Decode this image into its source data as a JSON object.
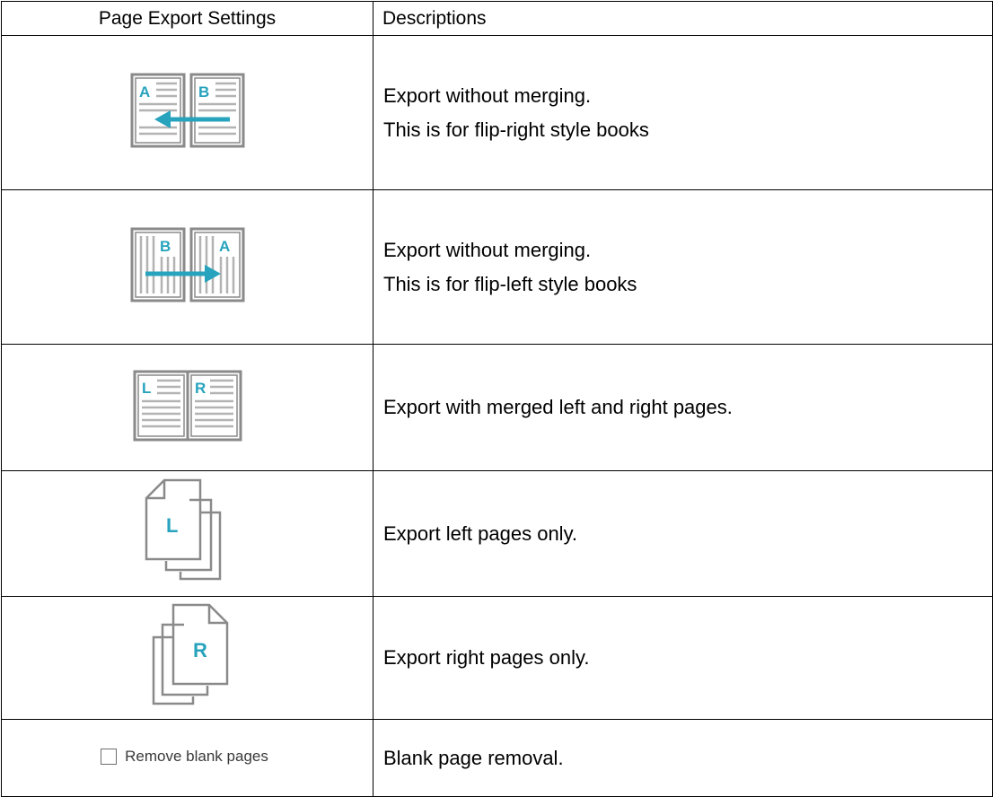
{
  "header": {
    "col1": "Page Export Settings",
    "col2": "Descriptions"
  },
  "colors": {
    "accent": "#27a3bd",
    "icon_gray": "#8a8a8a",
    "border": "#000000"
  },
  "rows": [
    {
      "icon": "flip-right-spread-icon",
      "letters": [
        "A",
        "B"
      ],
      "desc": [
        "Export without merging.",
        "This is for flip-right style books"
      ]
    },
    {
      "icon": "flip-left-spread-icon",
      "letters": [
        "B",
        "A"
      ],
      "desc": [
        "Export without merging.",
        "This is for flip-left style books"
      ]
    },
    {
      "icon": "merged-spread-icon",
      "letters": [
        "L",
        "R"
      ],
      "desc": [
        "Export with merged left and right pages."
      ]
    },
    {
      "icon": "left-pages-stack-icon",
      "letters": [
        "L"
      ],
      "desc": [
        "Export left pages only."
      ]
    },
    {
      "icon": "right-pages-stack-icon",
      "letters": [
        "R"
      ],
      "desc": [
        "Export right pages only."
      ]
    },
    {
      "icon": "checkbox-icon",
      "control_label": "Remove blank pages",
      "checked": false,
      "desc": [
        "Blank page removal."
      ]
    }
  ]
}
